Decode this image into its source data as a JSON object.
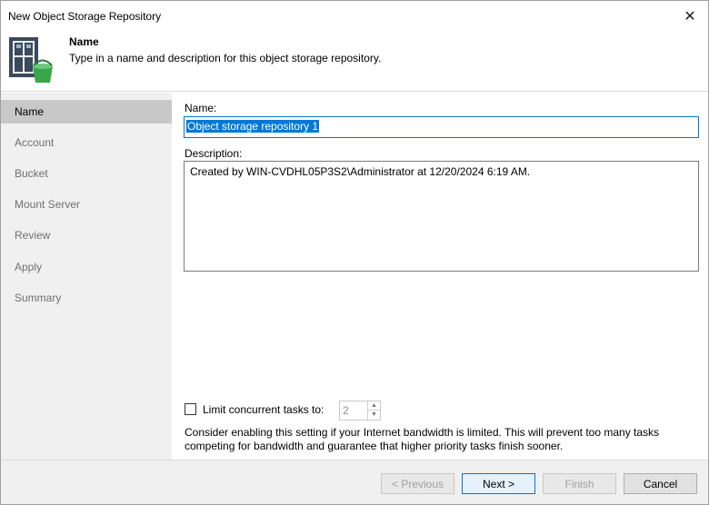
{
  "window": {
    "title": "New Object Storage Repository"
  },
  "header": {
    "icon": "object-storage-repository-icon",
    "title": "Name",
    "subtitle": "Type in a name and description for this object storage repository."
  },
  "sidebar": {
    "items": [
      {
        "label": "Name",
        "active": true
      },
      {
        "label": "Account",
        "active": false
      },
      {
        "label": "Bucket",
        "active": false
      },
      {
        "label": "Mount Server",
        "active": false
      },
      {
        "label": "Review",
        "active": false
      },
      {
        "label": "Apply",
        "active": false
      },
      {
        "label": "Summary",
        "active": false
      }
    ]
  },
  "form": {
    "name_label": "Name:",
    "name_value": "Object storage repository 1",
    "description_label": "Description:",
    "description_value": "Created by WIN-CVDHL05P3S2\\Administrator at 12/20/2024 6:19 AM.",
    "limit_label": "Limit concurrent tasks to:",
    "limit_checked": false,
    "limit_value": "2",
    "hint": "Consider enabling this setting if your Internet bandwidth is limited. This will prevent too many tasks competing for bandwidth and guarantee that higher priority tasks finish sooner."
  },
  "footer": {
    "previous_label": "< Previous",
    "next_label": "Next >",
    "finish_label": "Finish",
    "cancel_label": "Cancel"
  },
  "colors": {
    "accent": "#0078d7",
    "sidebar_bg": "#f0f0f0",
    "sidebar_active": "#c8c8c8",
    "bucket_green": "#3aa64a"
  }
}
